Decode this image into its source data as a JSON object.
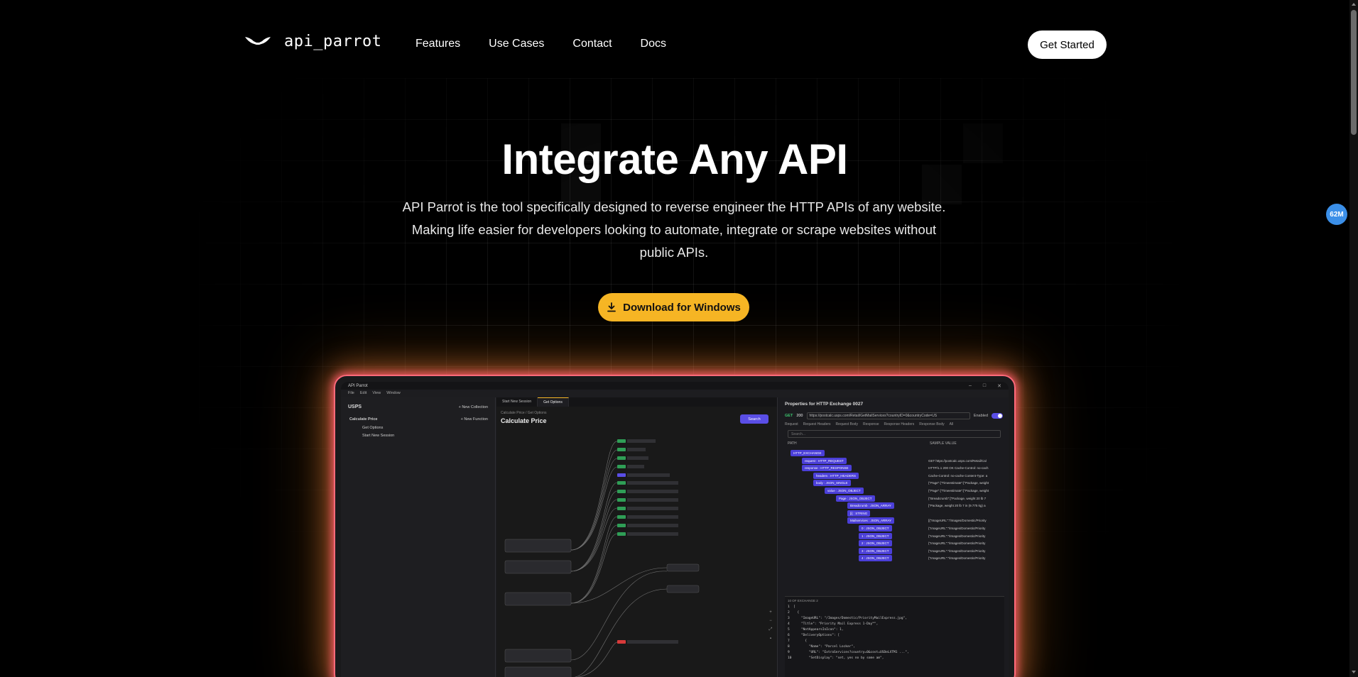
{
  "nav": {
    "logo_text": "api_parrot",
    "links": [
      "Features",
      "Use Cases",
      "Contact",
      "Docs"
    ],
    "cta_label": "Get Started"
  },
  "hero": {
    "title": "Integrate Any API",
    "subtitle": "API Parrot is the tool specifically designed to reverse engineer the HTTP APIs of any website. Making life easier for developers looking to automate, integrate or scrape websites without public APIs.",
    "download_label": "Download for Windows"
  },
  "badge": {
    "label": "62M"
  },
  "colors": {
    "accent": "#f6b625",
    "glow": "#ff6a7a",
    "brand_purple": "#5a4ee6"
  },
  "app": {
    "window_title": "API Parrot",
    "menu": [
      "File",
      "Edit",
      "View",
      "Window"
    ],
    "left": {
      "title": "USPS",
      "new_collection": "+ New Collection",
      "new_function": "+ New Function",
      "tree": [
        "Calculate Price",
        "Get Options",
        "Start New Session"
      ]
    },
    "mid": {
      "tabs": [
        "Start New Session",
        "Get Options"
      ],
      "breadcrumb": "Calculate Price  /  Get Options",
      "title": "Calculate Price",
      "search_label": "Search"
    },
    "right": {
      "title": "Properties for HTTP Exchange 0027",
      "method": "GET",
      "status": "200",
      "url": "https://postcalc.usps.com/Retail/GetMailServices?countryID=0&countryCode=US",
      "enabled_label": "Enabled",
      "tabs": [
        "Request",
        "Request Headers",
        "Request Body",
        "Response",
        "Response Headers",
        "Response Body",
        "All"
      ],
      "search_placeholder": "Search...",
      "col_path": "PATH",
      "col_sample": "SAMPLE VALUE",
      "tree_rows": [
        {
          "label": "HTTP_EXCHANGE",
          "sample": ""
        },
        {
          "label": "request : HTTP_REQUEST",
          "sample": "GET https://postcalc.usps.com/Retail/Cal"
        },
        {
          "label": "response : HTTP_RESPONSE",
          "sample": "HTTP/1.1 200 OK Cache-Control: no-cach"
        },
        {
          "label": "headers : HTTP_HEADERS",
          "sample": "Cache-Control: no-cache Content-Type: a"
        },
        {
          "label": "body : JSON_SINGLE",
          "sample": "{\"Page\":{\"Timeestimate\":[\"Package, weight"
        },
        {
          "label": "value : JSON_OBJECT",
          "sample": "{\"Page\":{\"Timeestimate\":[\"Package, weight"
        },
        {
          "label": "Page : JSON_OBJECT",
          "sample": "{\"Breadcrumb\":[\"Package, weight 20 lb 7"
        },
        {
          "label": "Breadcrumb : JSON_ARRAY",
          "sample": "[\"Package, weight 20 lb 7 in (9.775 kg) a"
        },
        {
          "label": "[i] : STRING",
          "sample": ""
        },
        {
          "label": "Mailservices : JSON_ARRAY",
          "sample": "[{\"ImageURL\":\"/Images/Domestic/Priority"
        },
        {
          "label": "0 : JSON_OBJECT",
          "sample": "{\"ImageURL\":\"/Images/Domestic/Priority"
        },
        {
          "label": "1 : JSON_OBJECT",
          "sample": "{\"ImageURL\":\"/Images/Domestic/Priority"
        },
        {
          "label": "2 : JSON_OBJECT",
          "sample": "{\"ImageURL\":\"/Images/Domestic/Priority"
        },
        {
          "label": "3 : JSON_OBJECT",
          "sample": "{\"ImageURL\":\"/Images/Domestic/Priority"
        },
        {
          "label": "4 : JSON_OBJECT",
          "sample": "{\"ImageURL\":\"/Images/Domestic/Priority"
        }
      ],
      "code_title": "10 OF EXCHANGE 2",
      "code_lines": [
        "1  [",
        "2    {",
        "3      \"ImageURL\": \"/Images/Domestic/PriorityMailExpress.jpg\",",
        "4      \"Title\": \"Priority Mail Express 1-Day™\",",
        "5      \"NotAppearsInIcon\": 1,",
        "6      \"DeliveryOptions\": [",
        "7        {",
        "8          \"Name\": \"Parcel Locker\",",
        "9          \"URL\": \"ExtraServices?country=0&cost=USDeLXTM1 ...\",",
        "10         \"SetDisplay\": \"set, yes no by some am\","
      ]
    }
  }
}
